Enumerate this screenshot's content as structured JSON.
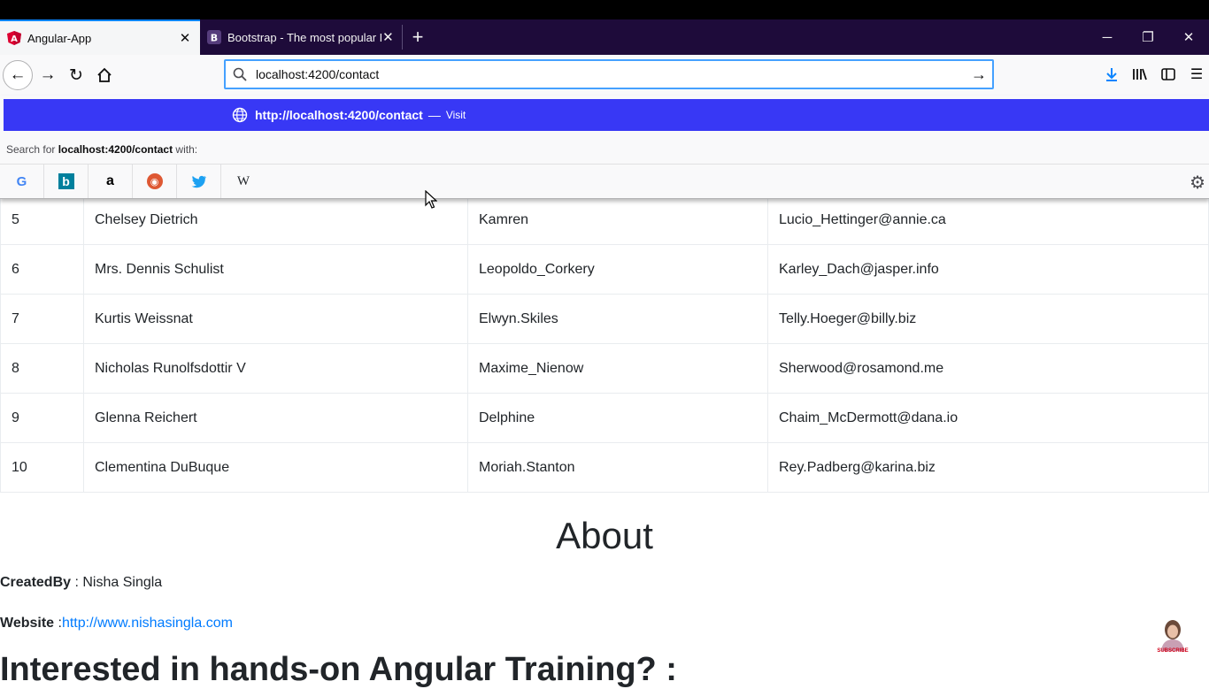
{
  "browser": {
    "tabs": [
      {
        "label": "Angular-App",
        "active": true
      },
      {
        "label": "Bootstrap - The most popular HTML",
        "active": false
      }
    ],
    "url": "localhost:4200/contact",
    "suggestion": {
      "url": "http://localhost:4200/contact",
      "dash": "—",
      "action": "Visit"
    },
    "search_with": {
      "prefix": "Search for",
      "query": "localhost:4200/contact",
      "suffix": "with:"
    },
    "search_engines": [
      "google-icon",
      "bing-icon",
      "amazon-icon",
      "duckduckgo-icon",
      "twitter-icon",
      "wikipedia-icon"
    ],
    "accent_color": "#3838f5"
  },
  "table": {
    "rows": [
      {
        "id": "5",
        "name": "Chelsey Dietrich",
        "username": "Kamren",
        "email": "Lucio_Hettinger@annie.ca"
      },
      {
        "id": "6",
        "name": "Mrs. Dennis Schulist",
        "username": "Leopoldo_Corkery",
        "email": "Karley_Dach@jasper.info"
      },
      {
        "id": "7",
        "name": "Kurtis Weissnat",
        "username": "Elwyn.Skiles",
        "email": "Telly.Hoeger@billy.biz"
      },
      {
        "id": "8",
        "name": "Nicholas Runolfsdottir V",
        "username": "Maxime_Nienow",
        "email": "Sherwood@rosamond.me"
      },
      {
        "id": "9",
        "name": "Glenna Reichert",
        "username": "Delphine",
        "email": "Chaim_McDermott@dana.io"
      },
      {
        "id": "10",
        "name": "Clementina DuBuque",
        "username": "Moriah.Stanton",
        "email": "Rey.Padberg@karina.biz"
      }
    ]
  },
  "about": {
    "title": "About",
    "created_by_label": "CreatedBy",
    "created_by_value": " : Nisha Singla",
    "website_label": "Website",
    "website_sep": " :",
    "website_url": "http://www.nishasingla.com",
    "training_heading": "Interested in hands-on Angular Training? :"
  },
  "overlay": {
    "subscribe_label": "SUBSCRIBE"
  }
}
